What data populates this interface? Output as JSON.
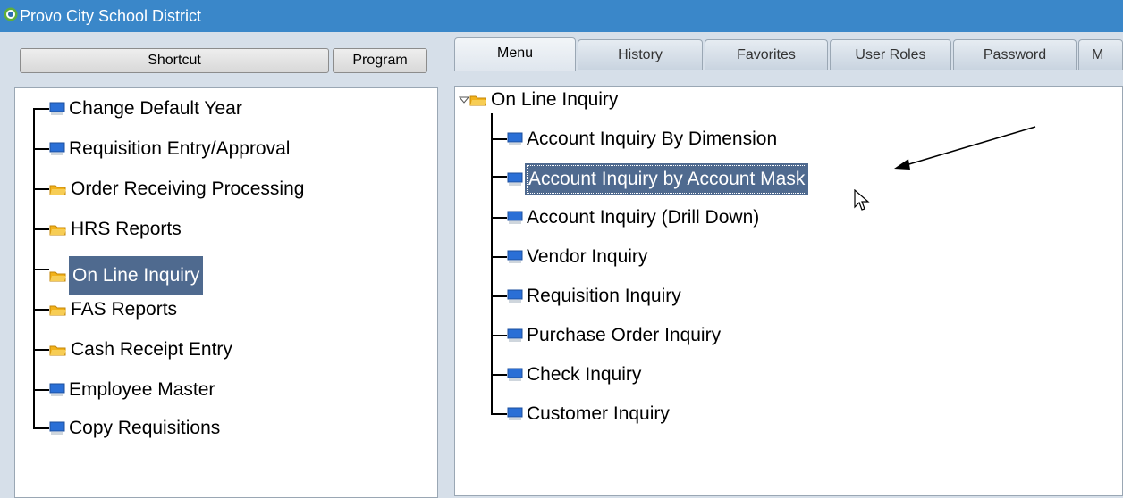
{
  "window": {
    "title": "Provo City School District"
  },
  "left_panel": {
    "shortcut_button": "Shortcut",
    "program_button": "Program",
    "tree": [
      {
        "label": "Change Default Year",
        "icon": "monitor-icon"
      },
      {
        "label": "Requisition Entry/Approval",
        "icon": "monitor-icon"
      },
      {
        "label": "Order Receiving Processing",
        "icon": "folder-icon"
      },
      {
        "label": "HRS Reports",
        "icon": "folder-icon"
      },
      {
        "label": "On Line Inquiry",
        "icon": "folder-icon",
        "selected": true
      },
      {
        "label": "FAS Reports",
        "icon": "folder-icon"
      },
      {
        "label": "Cash Receipt Entry",
        "icon": "folder-icon"
      },
      {
        "label": "Employee Master",
        "icon": "monitor-icon"
      },
      {
        "label": "Copy Requisitions",
        "icon": "monitor-icon"
      }
    ]
  },
  "tabs": [
    "Menu",
    "History",
    "Favorites",
    "User Roles",
    "Password",
    "M"
  ],
  "active_tab": "Menu",
  "right_panel": {
    "root": "On Line Inquiry",
    "items": [
      "Account Inquiry By Dimension",
      "Account Inquiry by Account Mask",
      "Account Inquiry (Drill Down)",
      "Vendor Inquiry",
      "Requisition Inquiry",
      "Purchase Order Inquiry",
      "Check Inquiry",
      "Customer Inquiry"
    ],
    "selected_item": "Account Inquiry by Account Mask"
  },
  "colors": {
    "titlebar": "#3a87c9",
    "selection": "#4f6a8f",
    "background": "#d6dfe9"
  }
}
